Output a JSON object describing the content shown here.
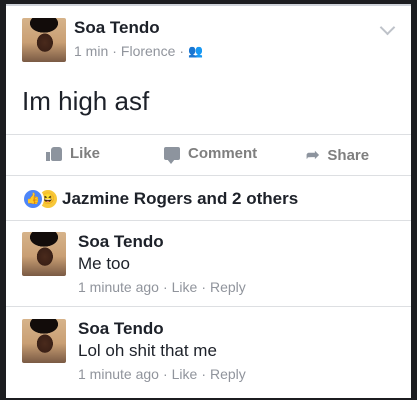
{
  "post": {
    "author": "Soa Tendo",
    "time": "1 min",
    "location": "Florence",
    "separator": "·",
    "text": "Im high asf"
  },
  "actions": {
    "like": "Like",
    "comment": "Comment",
    "share": "Share"
  },
  "reactions": {
    "summary": "Jazmine Rogers and 2 others"
  },
  "comments": [
    {
      "author": "Soa Tendo",
      "text": "Me too",
      "time": "1 minute ago",
      "like": "Like",
      "reply": "Reply"
    },
    {
      "author": "Soa Tendo",
      "text": "Lol oh shit that me",
      "time": "1 minute ago",
      "like": "Like",
      "reply": "Reply"
    }
  ],
  "icons": {
    "privacy": "friends-icon",
    "menu": "chevron-down-icon",
    "like": "thumbs-up-icon",
    "comment": "speech-bubble-icon",
    "share": "share-arrow-icon",
    "reaction_like": "like-reaction-icon",
    "reaction_haha": "haha-reaction-icon"
  },
  "colors": {
    "link_gray": "#90949c",
    "like_blue": "#4e86f7",
    "haha_yellow": "#f7c83a"
  }
}
